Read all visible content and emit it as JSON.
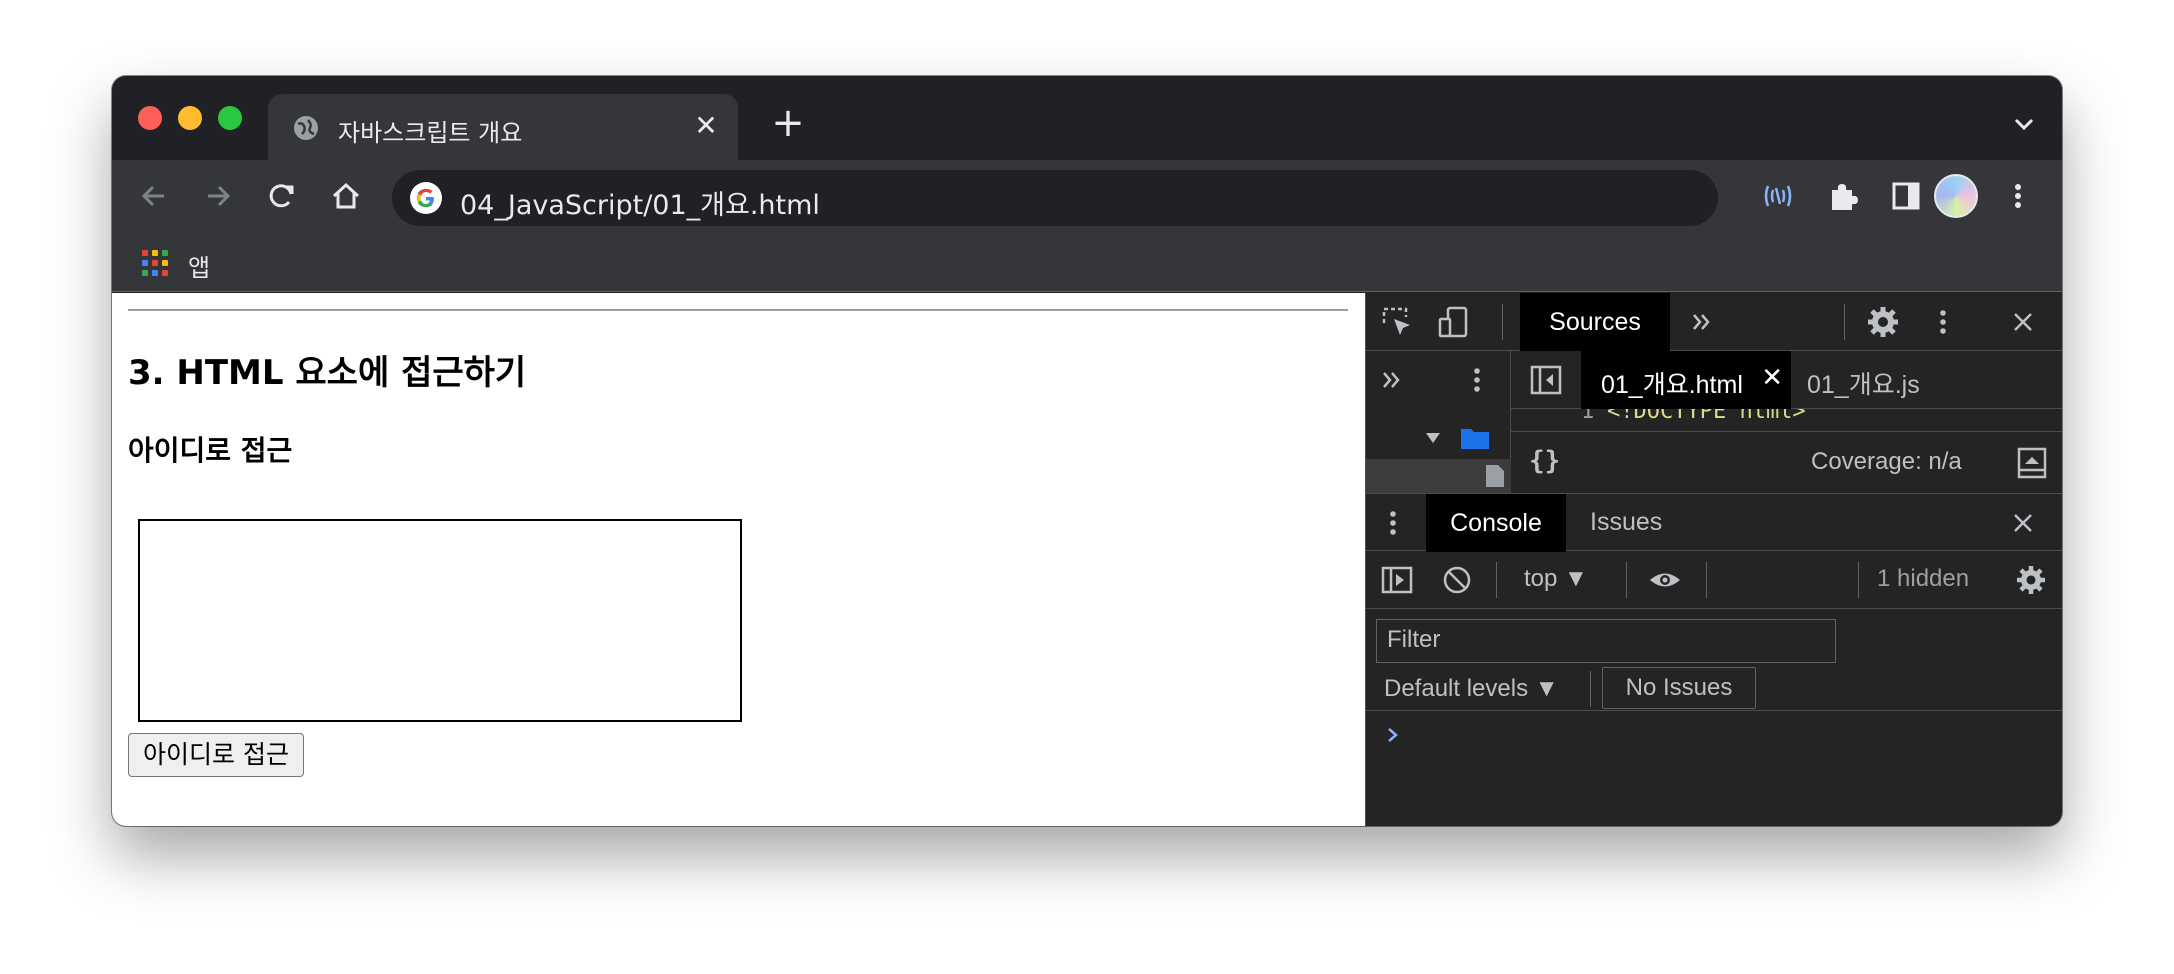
{
  "browser": {
    "tab_title": "자바스크립트 개요",
    "tab_close": "✕",
    "new_tab": "+",
    "url": "04_JavaScript/01_개요.html",
    "bookmarks": [
      {
        "label": "앱"
      }
    ]
  },
  "page": {
    "heading": "3. HTML 요소에 접근하기",
    "subheading": "아이디로 접근",
    "button_label": "아이디로 접근"
  },
  "devtools": {
    "main_tab": "Sources",
    "file_tabs": [
      {
        "label": "01_개요.html",
        "close": "✕"
      },
      {
        "label": "01_개요.js"
      }
    ],
    "code_snippet": "<!DOCTYPE html>",
    "pretty_print": "{}",
    "coverage": "Coverage: n/a",
    "drawer_tabs": [
      "Console",
      "Issues"
    ],
    "context": "top ▼",
    "hidden": "1 hidden",
    "filter_placeholder": "Filter",
    "levels": "Default levels ▼",
    "no_issues": "No Issues"
  },
  "colors": {
    "chrome_dark": "#202124",
    "toolbar": "#35363a",
    "devtools_bg": "#242424",
    "accent_blue": "#8ab4f8"
  }
}
